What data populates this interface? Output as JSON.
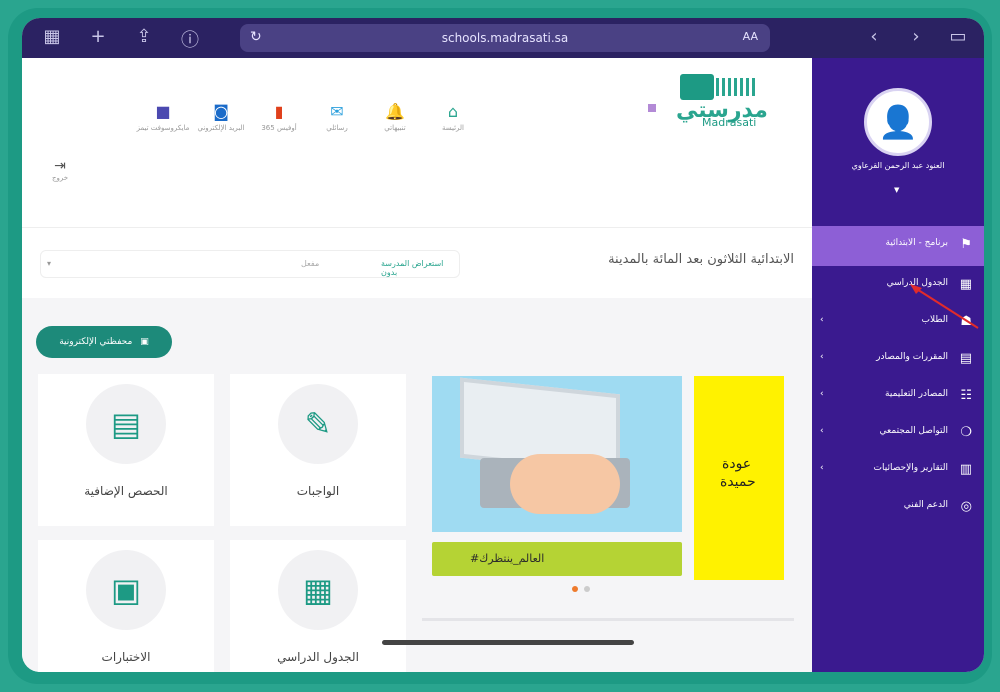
{
  "browser": {
    "url": "schools.madrasati.sa",
    "text_size": "AA"
  },
  "sidebar": {
    "user_name": "العنود عبد الرحمن القرعاوي",
    "items": [
      {
        "label": "برنامج - الابتدائية",
        "active": true
      },
      {
        "label": "الجدول الدراسي"
      },
      {
        "label": "الطلاب"
      },
      {
        "label": "المقررات والمصادر"
      },
      {
        "label": "المصادر التعليمية"
      },
      {
        "label": "التواصل المجتمعي"
      },
      {
        "label": "التقارير والإحصائيات"
      },
      {
        "label": "الدعم الفني"
      }
    ]
  },
  "logo": {
    "ar": "مدرستي",
    "en": "Madrasati"
  },
  "topnav": {
    "items": [
      {
        "label": "الرئيسة",
        "icon": "home-icon"
      },
      {
        "label": "تنبيهاتي",
        "icon": "bell-icon"
      },
      {
        "label": "رسائلي",
        "icon": "mail-icon"
      },
      {
        "label": "أوفيس 365",
        "icon": "office-icon"
      },
      {
        "label": "البريد الإلكتروني",
        "icon": "outlook-icon"
      },
      {
        "label": "مايكروسوفت تيمز",
        "icon": "teams-icon"
      }
    ],
    "logout": "خروج"
  },
  "school": {
    "name": "الابتدائية الثلاثون بعد المائة بالمدينة",
    "select_label": "استعراض المدرسة بدون",
    "select_hint": "مفعل"
  },
  "content": {
    "e_button": "محفظتي الإلكترونية",
    "cards": [
      {
        "label": "الواجبات",
        "icon": "homework-icon"
      },
      {
        "label": "الحصص الإضافية",
        "icon": "book-icon"
      },
      {
        "label": "الجدول الدراسي",
        "icon": "calendar-icon"
      },
      {
        "label": "الاختبارات",
        "icon": "exam-icon"
      }
    ],
    "banner": {
      "hashtag": "#العالم_ينتظرك",
      "yellow_line1": "عودة",
      "yellow_line2": "حميدة"
    }
  }
}
